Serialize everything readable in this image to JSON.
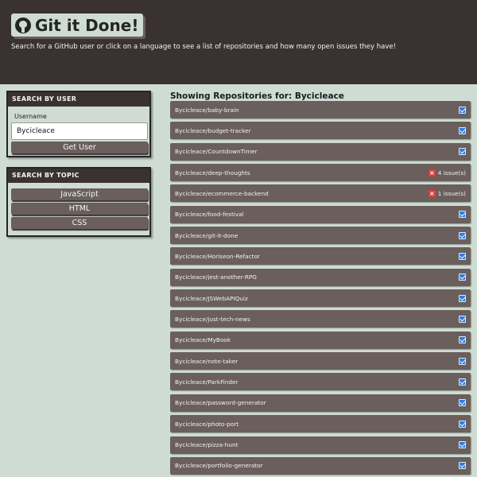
{
  "header": {
    "title": "Git it Done!",
    "subtitle": "Search for a GitHub user or click on a language to see a list of repositories and how many open issues they have!"
  },
  "user_search": {
    "heading": "SEARCH BY USER",
    "label": "Username",
    "value": "Bycicleace",
    "button": "Get User"
  },
  "topic_search": {
    "heading": "SEARCH BY TOPIC",
    "topics": [
      "JavaScript",
      "HTML",
      "CSS"
    ]
  },
  "results": {
    "title": "Showing Repositories for: Bycicleace",
    "repos": [
      {
        "name": "Bycicleace/baby-brain",
        "issues": ""
      },
      {
        "name": "Bycicleace/budget-tracker",
        "issues": ""
      },
      {
        "name": "Bycicleace/CountdownTimer",
        "issues": ""
      },
      {
        "name": "Bycicleace/deep-thoughts",
        "issues": "4 issue(s)"
      },
      {
        "name": "Bycicleace/ecommerce-backend",
        "issues": "1 issue(s)"
      },
      {
        "name": "Bycicleace/food-festival",
        "issues": ""
      },
      {
        "name": "Bycicleace/git-it-done",
        "issues": ""
      },
      {
        "name": "Bycicleace/Horiseon-Refactor",
        "issues": ""
      },
      {
        "name": "Bycicleace/jest-another-RPG",
        "issues": ""
      },
      {
        "name": "Bycicleace/JSWebAPIQuiz",
        "issues": ""
      },
      {
        "name": "Bycicleace/just-tech-news",
        "issues": ""
      },
      {
        "name": "Bycicleace/MyBook",
        "issues": ""
      },
      {
        "name": "Bycicleace/note-taker",
        "issues": ""
      },
      {
        "name": "Bycicleace/ParkFinder",
        "issues": ""
      },
      {
        "name": "Bycicleace/password-generator",
        "issues": ""
      },
      {
        "name": "Bycicleace/photo-port",
        "issues": ""
      },
      {
        "name": "Bycicleace/pizza-hunt",
        "issues": ""
      },
      {
        "name": "Bycicleace/portfolio-generator",
        "issues": ""
      }
    ]
  },
  "colors": {
    "background": "#cfdcd4",
    "header": "#3a3232",
    "button": "#6a5f5c",
    "check": "#2e7de0",
    "issue": "#e03a3a"
  }
}
